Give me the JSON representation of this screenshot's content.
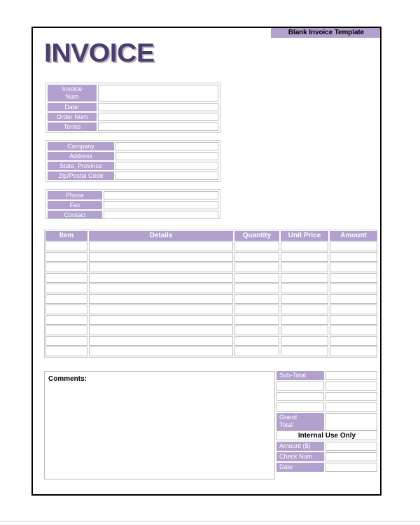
{
  "document": {
    "title": "INVOICE",
    "banner_label": "Blank Invoice Template"
  },
  "colors": {
    "accent_lavender": "#b2a1ce",
    "title_purple": "#4b3c73",
    "border_gray": "#bdbdbd",
    "page_border": "#000000"
  },
  "invoice_fields": [
    {
      "label": "Invoice\nNum",
      "value": ""
    },
    {
      "label": "Date:",
      "value": ""
    },
    {
      "label": "Order Num",
      "value": ""
    },
    {
      "label": "Terms",
      "value": ""
    }
  ],
  "company_fields": [
    {
      "label": "Company",
      "value": ""
    },
    {
      "label": "Address",
      "value": ""
    },
    {
      "label": "State, Province",
      "value": ""
    },
    {
      "label": "Zip/Postal Code",
      "value": ""
    }
  ],
  "contact_fields": [
    {
      "label": "Phone",
      "value": ""
    },
    {
      "label": "Fax",
      "value": ""
    },
    {
      "label": "Contact",
      "value": ""
    }
  ],
  "items_table": {
    "columns": [
      "Item",
      "Details",
      "Quantity",
      "Unit Price",
      "Amount"
    ],
    "row_count": 11,
    "rows": [
      {
        "item": "",
        "details": "",
        "quantity": "",
        "unit_price": "",
        "amount": ""
      },
      {
        "item": "",
        "details": "",
        "quantity": "",
        "unit_price": "",
        "amount": ""
      },
      {
        "item": "",
        "details": "",
        "quantity": "",
        "unit_price": "",
        "amount": ""
      },
      {
        "item": "",
        "details": "",
        "quantity": "",
        "unit_price": "",
        "amount": ""
      },
      {
        "item": "",
        "details": "",
        "quantity": "",
        "unit_price": "",
        "amount": ""
      },
      {
        "item": "",
        "details": "",
        "quantity": "",
        "unit_price": "",
        "amount": ""
      },
      {
        "item": "",
        "details": "",
        "quantity": "",
        "unit_price": "",
        "amount": ""
      },
      {
        "item": "",
        "details": "",
        "quantity": "",
        "unit_price": "",
        "amount": ""
      },
      {
        "item": "",
        "details": "",
        "quantity": "",
        "unit_price": "",
        "amount": ""
      },
      {
        "item": "",
        "details": "",
        "quantity": "",
        "unit_price": "",
        "amount": ""
      },
      {
        "item": "",
        "details": "",
        "quantity": "",
        "unit_price": "",
        "amount": ""
      }
    ]
  },
  "comments": {
    "label": "Comments:",
    "value": ""
  },
  "totals": {
    "rows": [
      {
        "label": "Sub-Total",
        "value": ""
      },
      {
        "label": "",
        "value": ""
      },
      {
        "label": "",
        "value": ""
      },
      {
        "label": "",
        "value": ""
      },
      {
        "label": "Grand\nTotal",
        "value": ""
      }
    ],
    "internal_use_label": "Internal Use Only",
    "internal_rows": [
      {
        "label": "Amount ($)",
        "value": ""
      },
      {
        "label": "Check Num",
        "value": ""
      },
      {
        "label": "Date",
        "value": ""
      }
    ]
  }
}
